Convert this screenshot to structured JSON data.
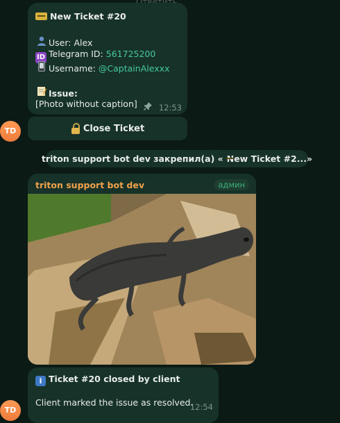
{
  "reply_hint": "Ответить",
  "ticket_message": {
    "title": "New Ticket #20",
    "user_label": "User: Alex",
    "telegram_id_label": "Telegram ID:",
    "telegram_id_value": "561725200",
    "username_label": "Username:",
    "username_value": "@CaptainAlexxx",
    "issue_label": "Issue:",
    "issue_text": "[Photo without caption]",
    "time": "12:53",
    "icons": [
      "ticket-icon",
      "user-icon",
      "id-icon",
      "phone-icon",
      "memo-icon",
      "pin-icon"
    ]
  },
  "keyboard": {
    "close_ticket_label": "Close Ticket"
  },
  "avatar_initials": "TD",
  "service_message": {
    "text": "triton support bot dev закрепил(а) «",
    "quote_text": "New Ticket #2...»"
  },
  "photo_message": {
    "sender": "triton support bot dev",
    "badge": "админ"
  },
  "closed_message": {
    "title": "Ticket #20 closed by client",
    "text": "Client marked the issue as resolved.",
    "time": "12:54"
  },
  "colors": {
    "background": "#0b1a15",
    "bubble": "#173228",
    "link": "#46c9a0",
    "sender_name": "#f0a14c",
    "admin_badge": "#3fae7c",
    "avatar": "#ef7b3b"
  }
}
